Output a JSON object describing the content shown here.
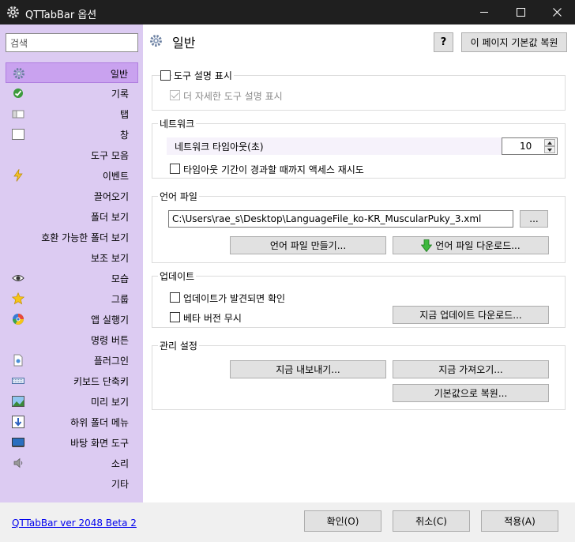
{
  "window": {
    "title": "QTTabBar 옵션"
  },
  "sidebar": {
    "search_placeholder": "검색",
    "items": [
      {
        "label": "일반",
        "icon": "gear-icon"
      },
      {
        "label": "기록",
        "icon": "history-icon"
      },
      {
        "label": "탭",
        "icon": "tab-icon"
      },
      {
        "label": "창",
        "icon": "window-icon"
      },
      {
        "label": "도구 모음",
        "icon": ""
      },
      {
        "label": "이벤트",
        "icon": "lightning-icon"
      },
      {
        "label": "끌어오기",
        "icon": ""
      },
      {
        "label": "폴더 보기",
        "icon": ""
      },
      {
        "label": "호환 가능한 폴더 보기",
        "icon": ""
      },
      {
        "label": "보조 보기",
        "icon": ""
      },
      {
        "label": "모습",
        "icon": "eye-icon"
      },
      {
        "label": "그룹",
        "icon": "star-icon"
      },
      {
        "label": "앱 실행기",
        "icon": "app-launcher-icon"
      },
      {
        "label": "명령 버튼",
        "icon": ""
      },
      {
        "label": "플러그인",
        "icon": "plugin-icon"
      },
      {
        "label": "키보드 단축키",
        "icon": "keyboard-icon"
      },
      {
        "label": "미리 보기",
        "icon": "preview-icon"
      },
      {
        "label": "하위 폴더 메뉴",
        "icon": "subfolder-icon"
      },
      {
        "label": "바탕 화면 도구",
        "icon": "desktop-icon"
      },
      {
        "label": "소리",
        "icon": "speaker-icon"
      },
      {
        "label": "기타",
        "icon": ""
      }
    ]
  },
  "header": {
    "title": "일반",
    "help_label": "?",
    "reset_page_label": "이 페이지 기본값 복원"
  },
  "tooltip_group": {
    "show_tooltip_label": "도구 설명 표시",
    "detailed_tooltip_label": "더 자세한 도구 설명 표시"
  },
  "network_group": {
    "legend": "네트워크",
    "timeout_label": "네트워크 타임아웃(초)",
    "timeout_value": "10",
    "retry_label": "타임아웃 기간이 경과할 때까지 액세스 재시도"
  },
  "language_group": {
    "legend": "언어 파일",
    "path_value": "C:\\Users\\rae_s\\Desktop\\LanguageFile_ko-KR_MuscularPuky_3.xml",
    "browse_label": "...",
    "create_label": "언어 파일 만들기...",
    "download_label": "언어 파일 다운로드..."
  },
  "update_group": {
    "legend": "업데이트",
    "check_label": "업데이트가 발견되면 확인",
    "ignore_beta_label": "베타 버전 무시",
    "download_now_label": "지금 업데이트 다운로드..."
  },
  "manage_group": {
    "legend": "관리 설정",
    "export_label": "지금 내보내기...",
    "import_label": "지금 가져오기...",
    "restore_defaults_label": "기본값으로 복원..."
  },
  "footer": {
    "version_link": "QTTabBar ver 2048 Beta 2",
    "ok_label": "확인(O)",
    "cancel_label": "취소(C)",
    "apply_label": "적용(A)"
  },
  "colors": {
    "sidebar_bg": "#dccbf2",
    "selected_bg": "#c9a2ef",
    "titlebar_bg": "#1f1f1f"
  }
}
